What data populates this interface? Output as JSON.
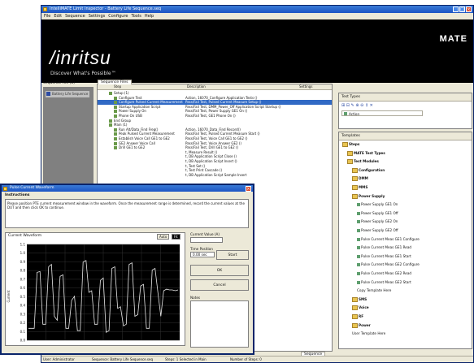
{
  "window": {
    "title": "IntelliMATE Limit Inspector - Battery Life Sequence.seq",
    "menu": [
      "File",
      "Edit",
      "Sequence",
      "Settings",
      "Configure",
      "Tools",
      "Help"
    ]
  },
  "banner": {
    "logo": "/inritsu",
    "tagline": "Discover What's Possible™",
    "product": "MATE"
  },
  "sequence_files": {
    "header": "Sequence File (1)",
    "items": [
      "Battery Life Sequence"
    ]
  },
  "sequence_panel": {
    "tab": "Sequence Files",
    "columns": [
      "Step",
      "Description",
      "Settings"
    ],
    "rows": [
      {
        "step": "Setup (1)",
        "desc": "",
        "sel": false
      },
      {
        "step": "Configure Test",
        "desc": "Action, 16070_Configure Application Tests ()",
        "sel": false
      },
      {
        "step": "Configure Pulsed Current Measurement",
        "desc": "Pass/Fail Test, Pulsed Current Measure Setup ()",
        "sel": true
      },
      {
        "step": "Startup Application Script",
        "desc": "Pass/Fail Test, DMM_Power_Off Application Script Startup ()",
        "sel": false
      },
      {
        "step": "Power Supply On",
        "desc": "Pass/Fail Test, Power Supply GE1 On ()",
        "sel": false
      },
      {
        "step": "Phone On USB",
        "desc": "Pass/Fail Test, GE1 Phone On ()",
        "sel": false
      },
      {
        "step": "End Group",
        "desc": "",
        "sel": false
      },
      {
        "step": "Main (1)",
        "desc": "",
        "sel": false
      },
      {
        "step": "Run Alt/Data_Find Freq()",
        "desc": "Action, 16070_Data_Find Record()",
        "sel": false
      },
      {
        "step": "Peak Pulsed Current Measurement",
        "desc": "Pass/Fail Test, Pulsed Current Measure Start ()",
        "sel": false
      },
      {
        "step": "Establish Voice Call GE1 to GE2",
        "desc": "Pass/Fail Test, Voice Call GE1 to GE2 ()",
        "sel": false
      },
      {
        "step": "GE2 Answer Voice Call",
        "desc": "Pass/Fail Test, Voice Answer GE2 ()",
        "sel": false
      },
      {
        "step": "Drill GE1 to GE2",
        "desc": "Pass/Fail Test, Drill GE1 to GE2 ()",
        "sel": false
      },
      {
        "step": "",
        "desc": "t, Measure Result ()",
        "sel": false
      },
      {
        "step": "",
        "desc": "t, DB Application Script Close ()",
        "sel": false
      },
      {
        "step": "",
        "desc": "t, DB Application Script Insert ()",
        "sel": false
      },
      {
        "step": "",
        "desc": "t, Test Set ()",
        "sel": false
      },
      {
        "step": "",
        "desc": "t, Test Print Cascade ()",
        "sel": false
      },
      {
        "step": "",
        "desc": "t, DB Application Script Sample Insert",
        "sel": false
      }
    ],
    "bottom_tab": "Sequence"
  },
  "test_types": {
    "header": "Test Types",
    "toolbar": "⊞ ⊟ ✎ ⊕ ⊖ ↕ ✕",
    "selected": "Action"
  },
  "templates": {
    "header": "Templates",
    "items": [
      {
        "label": "Steps",
        "level": 0,
        "kind": "folder"
      },
      {
        "label": "MATE Test Types",
        "level": 1,
        "kind": "folder"
      },
      {
        "label": "Test Modules",
        "level": 1,
        "kind": "folder"
      },
      {
        "label": "Configuration",
        "level": 2,
        "kind": "folder"
      },
      {
        "label": "DMM",
        "level": 2,
        "kind": "folder"
      },
      {
        "label": "MMS",
        "level": 2,
        "kind": "folder"
      },
      {
        "label": "Power Supply",
        "level": 2,
        "kind": "folder"
      },
      {
        "label": "Power Supply GE1 On",
        "level": 3,
        "kind": "leaf"
      },
      {
        "label": "Power Supply GE1 Off",
        "level": 3,
        "kind": "leaf"
      },
      {
        "label": "Power Supply GE2 On",
        "level": 3,
        "kind": "leaf"
      },
      {
        "label": "Power Supply GE2 Off",
        "level": 3,
        "kind": "leaf"
      },
      {
        "label": "Pulse Current Meas GE1 Configure",
        "level": 3,
        "kind": "leaf"
      },
      {
        "label": "Pulse Current Meas GE1 Read",
        "level": 3,
        "kind": "leaf"
      },
      {
        "label": "Pulse Current Meas GE1 Start",
        "level": 3,
        "kind": "leaf"
      },
      {
        "label": "Pulse Current Meas GE2 Configure",
        "level": 3,
        "kind": "leaf"
      },
      {
        "label": "Pulse Current Meas GE2 Read",
        "level": 3,
        "kind": "leaf"
      },
      {
        "label": "Pulse Current Meas GE2 Start",
        "level": 3,
        "kind": "leaf"
      },
      {
        "label": "Copy Template Here",
        "level": 3,
        "kind": "text"
      },
      {
        "label": "SMS",
        "level": 2,
        "kind": "folder"
      },
      {
        "label": "Voice",
        "level": 2,
        "kind": "folder"
      },
      {
        "label": "RF",
        "level": 2,
        "kind": "folder"
      },
      {
        "label": "Power",
        "level": 2,
        "kind": "folder"
      },
      {
        "label": "User Template Here",
        "level": 2,
        "kind": "text"
      }
    ]
  },
  "status_bar": [
    "User: Administrator",
    "Sequence: Battery Life Sequence.seq",
    "Steps: 1 Selected in Main",
    "Number of Steps: 0"
  ],
  "dialog": {
    "title": "Pulse Current Waveform",
    "instructions_title": "Instructions",
    "instructions": "Please position PTE current measurement window in the waveform. Once the measurement range is determined, record the current values at the DUT and then click OK to continue.",
    "chart_title": "Current Waveform",
    "zoom_labels": [
      "Auto",
      "Fit"
    ],
    "current_label": "Current Value (A)",
    "current_value": "",
    "time_label": "Time Position",
    "time_value": "0.00 sec",
    "start_button": "Start",
    "ok_button": "OK",
    "cancel_button": "Cancel",
    "notes_label": "Notes"
  },
  "chart_data": {
    "type": "line",
    "title": "Current Waveform",
    "xlabel": "",
    "ylabel": "Current",
    "ylim": [
      0,
      1.2
    ],
    "yticks": [
      "1.1",
      "1.0",
      "0.9",
      "0.8",
      "0.7",
      "0.6",
      "0.5",
      "0.4",
      "0.3",
      "0.2",
      "0.1",
      "0.0"
    ],
    "series": [
      {
        "values": [
          0.15,
          0.15,
          0.15,
          0.85,
          0.86,
          0.2,
          0.2,
          0.92,
          0.95,
          0.3,
          0.25,
          0.8,
          0.82,
          0.15,
          0.15,
          0.5,
          0.55,
          0.12,
          0.12,
          0.98,
          1.0,
          0.6,
          0.62,
          0.2,
          0.2,
          0.75,
          0.78,
          0.1,
          0.12,
          0.9,
          0.92,
          0.4,
          0.42,
          0.18,
          0.2,
          0.95,
          0.97,
          0.3,
          0.32,
          0.68,
          0.7,
          0.15,
          0.15,
          0.88,
          0.9,
          0.6,
          0.3,
          0.62,
          0.64,
          0.63,
          0.63,
          0.62,
          0.63
        ]
      }
    ]
  }
}
